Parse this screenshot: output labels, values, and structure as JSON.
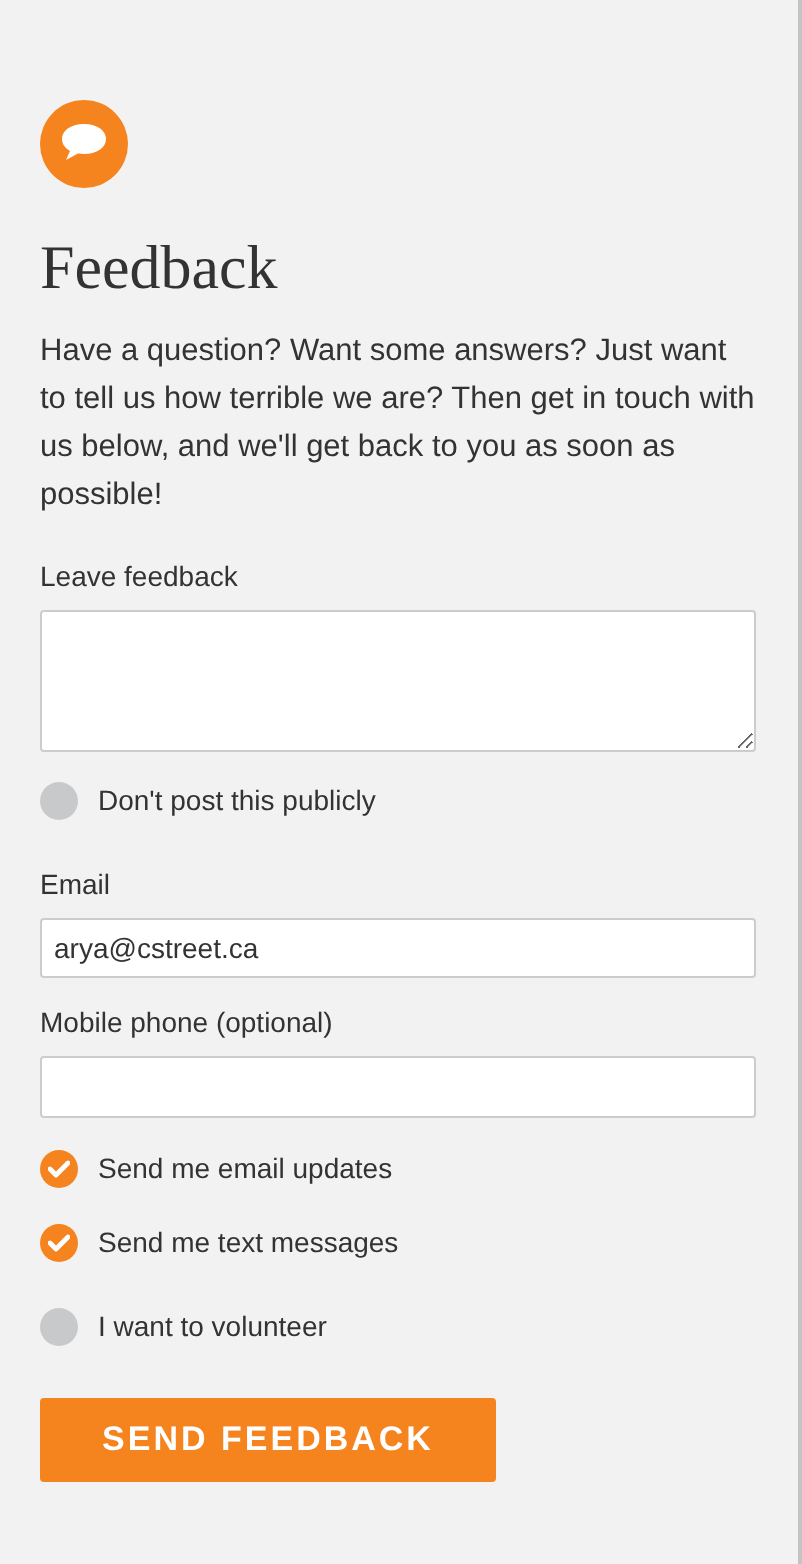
{
  "title": "Feedback",
  "intro": "Have a question? Want some answers? Just want to tell us how terrible we are? Then get in touch with us below, and we'll get back to you as soon as possible!",
  "feedback_field": {
    "label": "Leave feedback"
  },
  "private_option": {
    "label": "Don't post this publicly",
    "checked": false
  },
  "email_field": {
    "label": "Email",
    "value": "arya@cstreet.ca"
  },
  "phone_field": {
    "label": "Mobile phone (optional)"
  },
  "options": [
    {
      "label": "Send me email updates",
      "checked": true
    },
    {
      "label": "Send me text messages",
      "checked": true
    },
    {
      "label": "I want to volunteer",
      "checked": false
    }
  ],
  "submit_button": "SEND FEEDBACK"
}
